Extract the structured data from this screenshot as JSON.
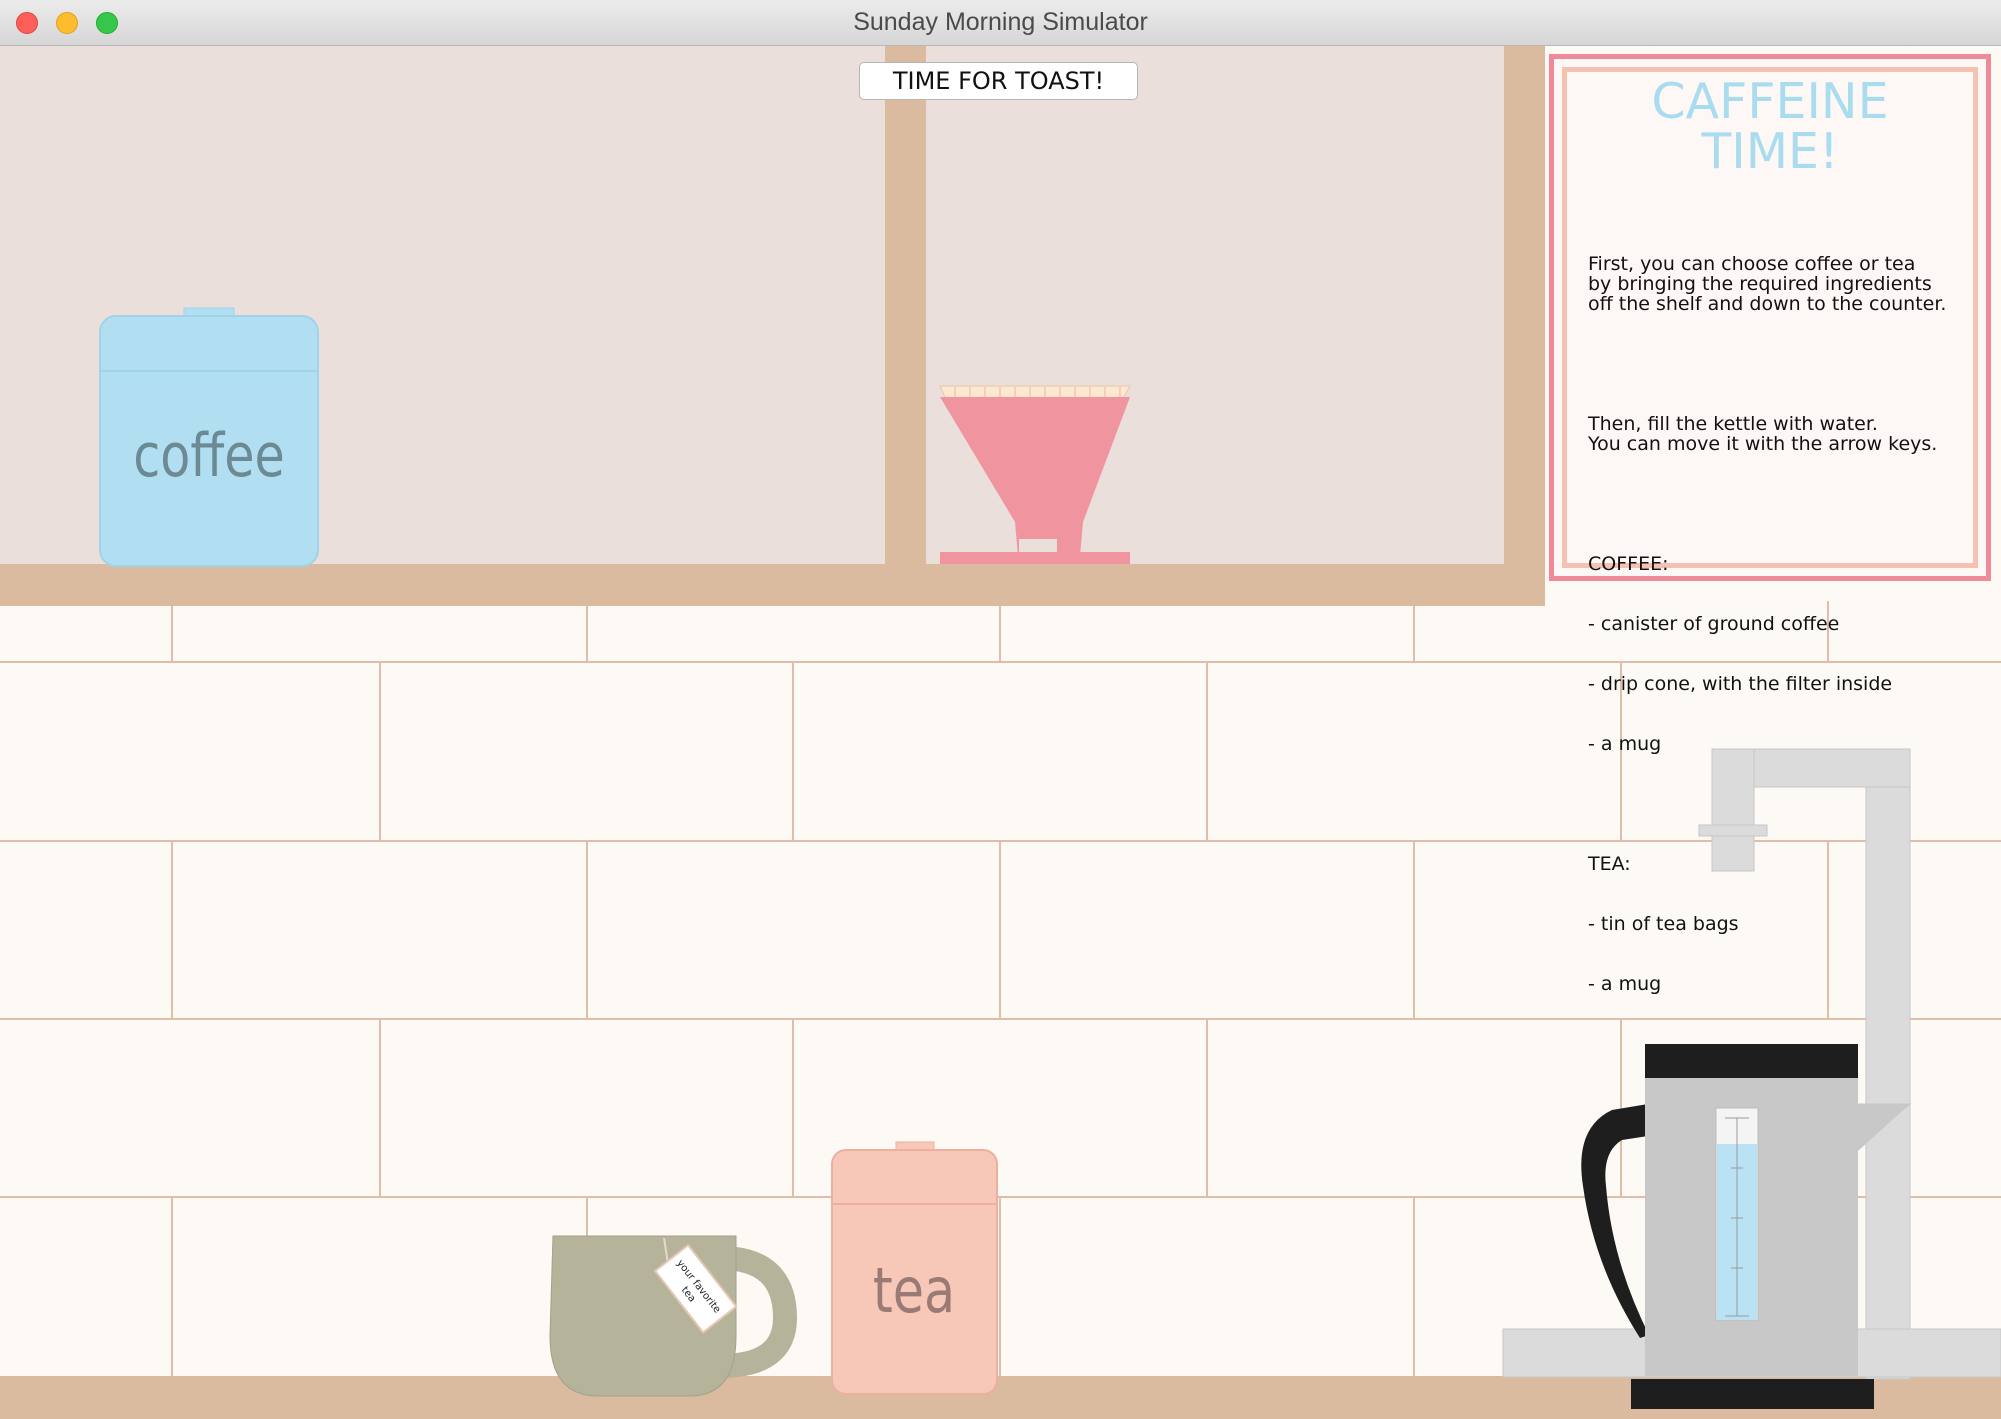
{
  "window": {
    "title": "Sunday Morning Simulator"
  },
  "controls": {
    "toast_button_label": "TIME FOR TOAST!"
  },
  "poster": {
    "title_line1": "CAFFEINE",
    "title_line2": "TIME!",
    "intro": "First, you can choose coffee or tea\nby bringing the required ingredients\noff the shelf and down to the counter.",
    "kettle_instructions": "Then, fill the kettle with water.\nYou can move it with the arrow keys.",
    "coffee_heading": "COFFEE:",
    "coffee_items": [
      "- canister of ground coffee",
      "- drip cone, with the filter inside",
      "- a mug"
    ],
    "tea_heading": "TEA:",
    "tea_items": [
      "- tin of tea bags",
      "- a mug"
    ]
  },
  "items": {
    "coffee_canister_label": "coffee",
    "tea_tin_label": "tea",
    "tea_tag_line1": "your favorite",
    "tea_tag_line2": "tea"
  },
  "colors": {
    "wall": "#fdf9f5",
    "tile_grout": "#e0bda8",
    "cabinet_wood": "#dbbb9f",
    "cabinet_back": "#eadfdb",
    "coffee_canister": "#b1dff1",
    "tea_tin": "#f7c7b7",
    "drip_cone": "#f095a0",
    "mug": "#b5b39a",
    "kettle_body": "#c8c8c8",
    "kettle_handle": "#1e1e1e",
    "poster_border": "#ee8a9a",
    "poster_title": "#aadcf0"
  }
}
